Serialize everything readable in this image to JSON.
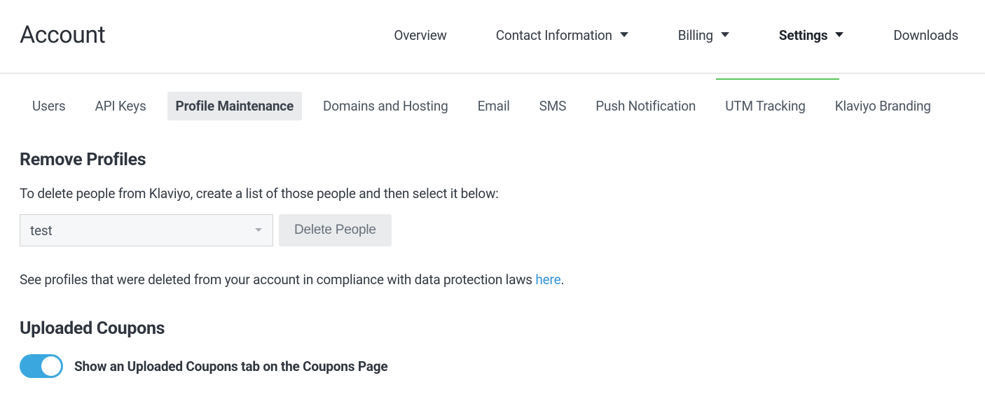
{
  "header": {
    "title": "Account",
    "nav": {
      "overview": "Overview",
      "contact": "Contact Information",
      "billing": "Billing",
      "settings": "Settings",
      "downloads": "Downloads"
    }
  },
  "subtabs": {
    "users": "Users",
    "api_keys": "API Keys",
    "profile_maintenance": "Profile Maintenance",
    "domains": "Domains and Hosting",
    "email": "Email",
    "sms": "SMS",
    "push": "Push Notification",
    "utm": "UTM Tracking",
    "branding": "Klaviyo Branding"
  },
  "remove_profiles": {
    "title": "Remove Profiles",
    "description": "To delete people from Klaviyo, create a list of those people and then select it below:",
    "select_value": "test",
    "delete_label": "Delete People",
    "info_prefix": "See profiles that were deleted from your account in compliance with data protection laws ",
    "info_link": "here",
    "info_suffix": "."
  },
  "uploaded_coupons": {
    "title": "Uploaded Coupons",
    "toggle_label": "Show an Uploaded Coupons tab on the Coupons Page"
  }
}
